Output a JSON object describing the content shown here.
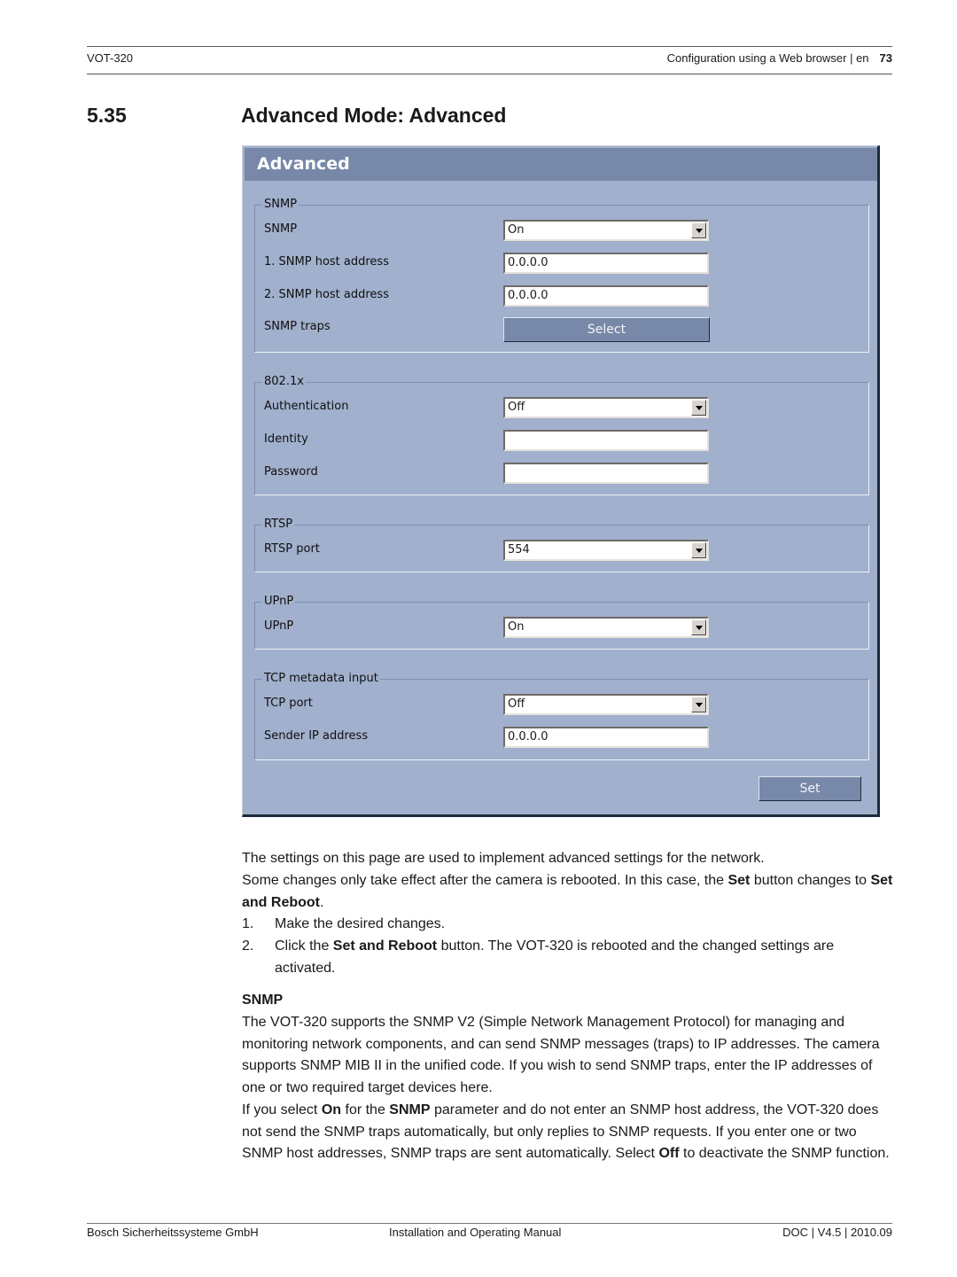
{
  "page_header": {
    "product": "VOT-320",
    "chapter": "Configuration using a Web browser | en",
    "page_number": "73"
  },
  "section": {
    "number": "5.35",
    "title": "Advanced Mode: Advanced"
  },
  "panel": {
    "title": "Advanced",
    "colors": {
      "background": "#a1b0cc",
      "header": "#7788a8",
      "button": "#7788a8"
    },
    "groups": [
      {
        "legend": "SNMP",
        "rows": [
          {
            "label": "SNMP",
            "type": "select",
            "value": "On"
          },
          {
            "label": "1. SNMP host address",
            "type": "text",
            "value": "0.0.0.0"
          },
          {
            "label": "2. SNMP host address",
            "type": "text",
            "value": "0.0.0.0"
          },
          {
            "label": "SNMP traps",
            "type": "button",
            "value": "Select"
          }
        ]
      },
      {
        "legend": "802.1x",
        "rows": [
          {
            "label": "Authentication",
            "type": "select",
            "value": "Off"
          },
          {
            "label": "Identity",
            "type": "text",
            "value": ""
          },
          {
            "label": "Password",
            "type": "password",
            "value": ""
          }
        ]
      },
      {
        "legend": "RTSP",
        "rows": [
          {
            "label": "RTSP port",
            "type": "select",
            "value": "554"
          }
        ]
      },
      {
        "legend": "UPnP",
        "rows": [
          {
            "label": "UPnP",
            "type": "select",
            "value": "On"
          }
        ]
      },
      {
        "legend": "TCP metadata input",
        "rows": [
          {
            "label": "TCP port",
            "type": "select",
            "value": "Off"
          },
          {
            "label": "Sender IP address",
            "type": "text",
            "value": "0.0.0.0"
          }
        ]
      }
    ],
    "set_button": "Set"
  },
  "body": {
    "intro1": "The settings on this page are used to implement advanced settings for the network.",
    "intro2_a": "Some changes only take effect after the camera is rebooted. In this case, the ",
    "intro2_b": "Set",
    "intro2_c": " button changes to ",
    "intro2_d": "Set and Reboot",
    "intro2_e": ".",
    "steps": [
      {
        "num": "1.",
        "a": "Make the desired changes.",
        "b": "",
        "c": ""
      },
      {
        "num": "2.",
        "a": "Click the ",
        "b": "Set and Reboot",
        "c": " button. The VOT-320 is rebooted and the changed settings are activated."
      }
    ],
    "snmp_heading": "SNMP",
    "snmp_p1": "The VOT-320 supports the SNMP V2 (Simple Network Management Protocol) for managing and monitoring network components, and can send SNMP messages (traps) to IP addresses. The camera supports SNMP MIB II in the unified code. If you wish to send SNMP traps, enter the IP addresses of one or two required target devices here.",
    "snmp_p2_a": "If you select ",
    "snmp_p2_b": "On",
    "snmp_p2_c": " for the ",
    "snmp_p2_d": "SNMP",
    "snmp_p2_e": " parameter and do not enter an SNMP host address, the VOT-320 does not send the SNMP traps automatically, but only replies to SNMP requests. If you enter one or two SNMP host addresses, SNMP traps are sent automatically. Select ",
    "snmp_p2_f": "Off",
    "snmp_p2_g": " to deactivate the SNMP function."
  },
  "page_footer": {
    "company": "Bosch Sicherheitssysteme GmbH",
    "manual": "Installation and Operating Manual",
    "doc": "DOC | V4.5 | 2010.09"
  }
}
